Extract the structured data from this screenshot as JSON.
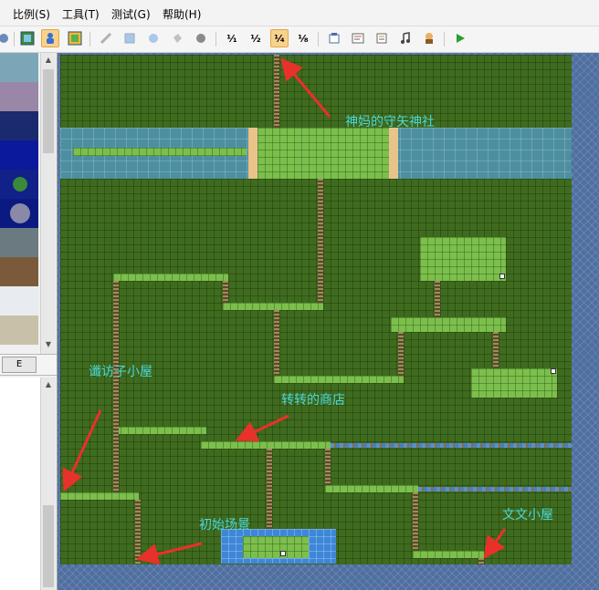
{
  "menu": [
    "比例(S)",
    "工具(T)",
    "测试(G)",
    "帮助(H)"
  ],
  "toolbar": {
    "icons": [
      "map-icon",
      "event-icon",
      "region-icon",
      "pencil-icon",
      "rectangle-icon",
      "ellipse-icon",
      "fill-icon",
      "shadow-icon",
      "scale-1-1-icon",
      "scale-1-2-icon",
      "scale-1-4-icon",
      "scale-1-8-icon",
      "resource-manager-icon",
      "script-editor-icon",
      "database-icon",
      "sound-test-icon",
      "character-icon",
      "playtest-icon"
    ],
    "scale_labels": [
      "¹⁄₁",
      "¹⁄₂",
      "¹⁄₄",
      "¹⁄₈"
    ],
    "active_scale": "¹⁄₄"
  },
  "tileset": {
    "tab_label": "E"
  },
  "map": {
    "labels": {
      "shrine": "神妈的守矢神社",
      "visit_house": "谶访子小屋",
      "shop": "转转的商店",
      "start": "初始场景",
      "wenwen": "文文小屋"
    }
  },
  "colors": {
    "arrow": "#e8312a",
    "label": "#4ad9d9",
    "grass": "#3f6b1e",
    "light_grass": "#7cbf4c"
  }
}
